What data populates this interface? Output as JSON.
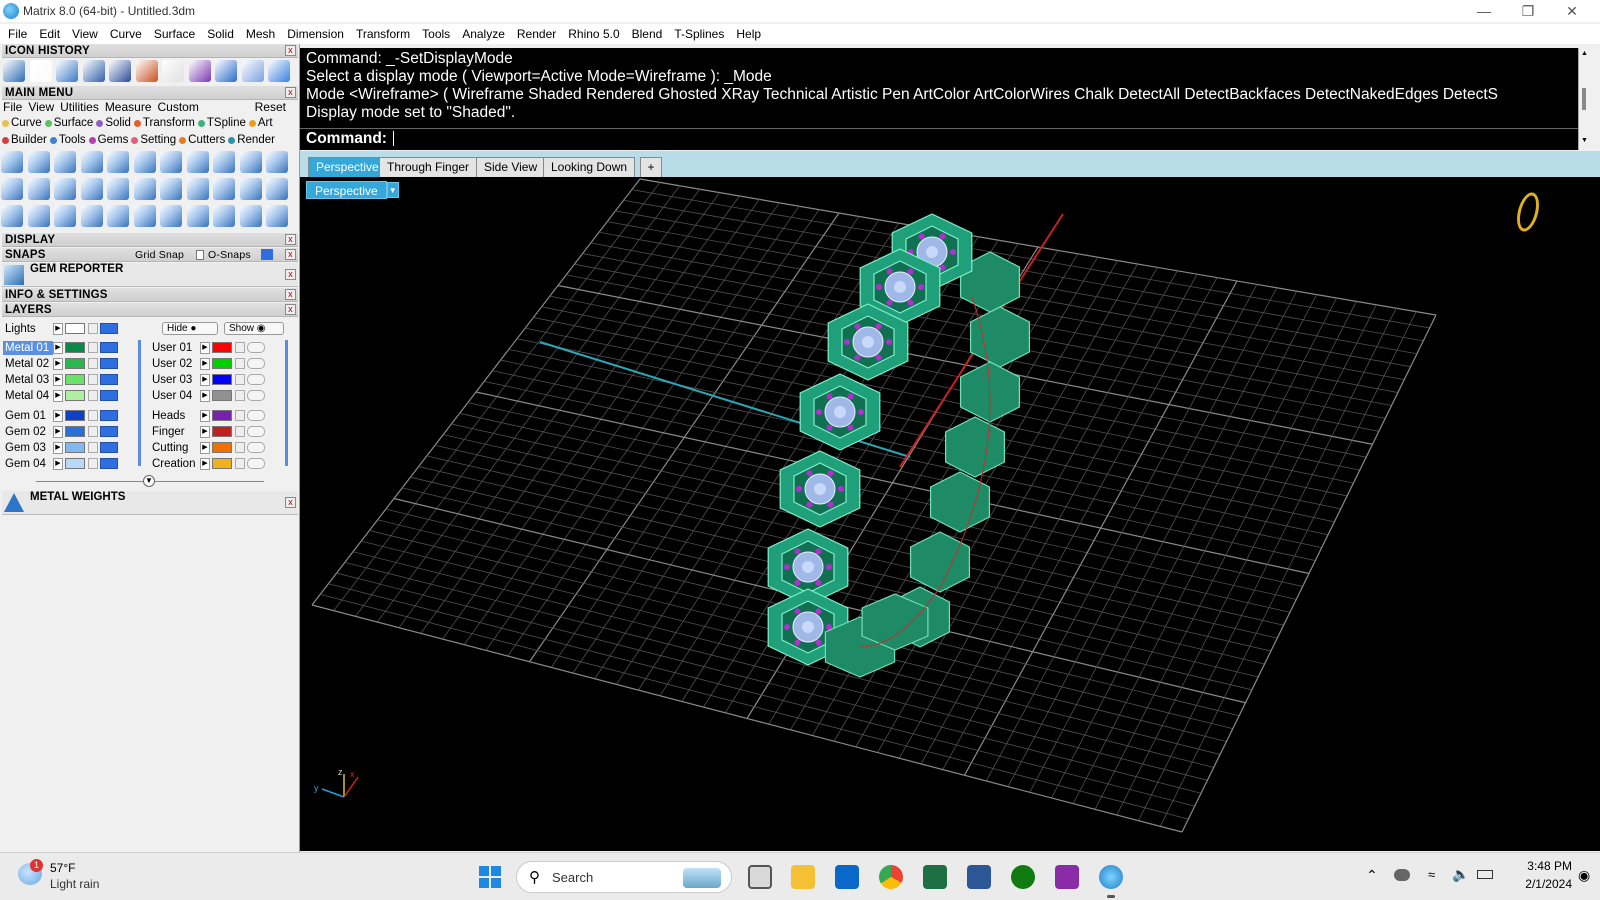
{
  "window": {
    "title": "Matrix 8.0 (64-bit) - Untitled.3dm"
  },
  "menubar": [
    "File",
    "Edit",
    "View",
    "Curve",
    "Surface",
    "Solid",
    "Mesh",
    "Dimension",
    "Transform",
    "Tools",
    "Analyze",
    "Render",
    "Rhino 5.0",
    "Blend",
    "T-Splines",
    "Help"
  ],
  "panels": {
    "icon_history": "ICON HISTORY",
    "main_menu": "MAIN MENU",
    "display": "DISPLAY",
    "snaps": "SNAPS",
    "grid_snap": "Grid Snap",
    "osnaps": "O-Snaps",
    "gem_reporter": "GEM REPORTER",
    "info_settings": "INFO & SETTINGS",
    "layers": "LAYERS",
    "metal_weights": "METAL WEIGHTS"
  },
  "main_menu": {
    "items": [
      "File",
      "View",
      "Utilities",
      "Measure",
      "Custom"
    ],
    "reset": "Reset",
    "categories_row1": [
      {
        "label": "Curve",
        "color": "#e8c050"
      },
      {
        "label": "Surface",
        "color": "#60c060"
      },
      {
        "label": "Solid",
        "color": "#9060c0"
      },
      {
        "label": "Transform",
        "color": "#e06030"
      },
      {
        "label": "TSpline",
        "color": "#40b080"
      },
      {
        "label": "Art",
        "color": "#e8a020"
      }
    ],
    "categories_row2": [
      {
        "label": "Builder",
        "color": "#d04040"
      },
      {
        "label": "Tools",
        "color": "#4080d0"
      },
      {
        "label": "Gems",
        "color": "#b040b0"
      },
      {
        "label": "Setting",
        "color": "#e06080"
      },
      {
        "label": "Cutters",
        "color": "#e08020"
      },
      {
        "label": "Render",
        "color": "#3090b0"
      }
    ]
  },
  "layers": {
    "lights": "Lights",
    "hide": "Hide",
    "show": "Show",
    "left": [
      {
        "name": "Metal 01",
        "color": "#0a8a4a"
      },
      {
        "name": "Metal 02",
        "color": "#2ab84e"
      },
      {
        "name": "Metal 03",
        "color": "#6be06b"
      },
      {
        "name": "Metal 04",
        "color": "#aef0a0"
      },
      {
        "name": "Gem 01",
        "color": "#1040c8"
      },
      {
        "name": "Gem 02",
        "color": "#2a70d8"
      },
      {
        "name": "Gem 03",
        "color": "#80b8f0"
      },
      {
        "name": "Gem 04",
        "color": "#b8d8f8"
      }
    ],
    "right": [
      {
        "name": "User 01",
        "color": "#ff0000"
      },
      {
        "name": "User 02",
        "color": "#00d000"
      },
      {
        "name": "User 03",
        "color": "#0000ff"
      },
      {
        "name": "User 04",
        "color": "#909090"
      },
      {
        "name": "Heads",
        "color": "#7a20b0"
      },
      {
        "name": "Finger",
        "color": "#c02020"
      },
      {
        "name": "Cutting",
        "color": "#f07000"
      },
      {
        "name": "Creation",
        "color": "#f0b020"
      }
    ]
  },
  "command": {
    "lines": [
      "Command: _-SetDisplayMode",
      "Select a display mode ( Viewport=Active  Mode=Wireframe ): _Mode",
      "Mode <Wireframe> ( Wireframe  Shaded  Rendered  Ghosted  XRay  Technical  Artistic  Pen  ArtColor  ArtColorWires  Chalk  DetectAll  DetectBackfaces  DetectNakedEdges  DetectS",
      "Display mode set to \"Shaded\"."
    ],
    "prompt": "Command:"
  },
  "viewport": {
    "tabs": [
      "Perspective",
      "Through Finger",
      "Side View",
      "Looking Down"
    ],
    "active_tab": "Perspective",
    "label": "Perspective",
    "axis_x": "x",
    "axis_y": "y",
    "axis_z": "z"
  },
  "taskbar": {
    "weather_temp": "57°F",
    "weather_desc": "Light rain",
    "weather_badge": "1",
    "search": "Search",
    "time": "3:48 PM",
    "date": "2/1/2024"
  }
}
